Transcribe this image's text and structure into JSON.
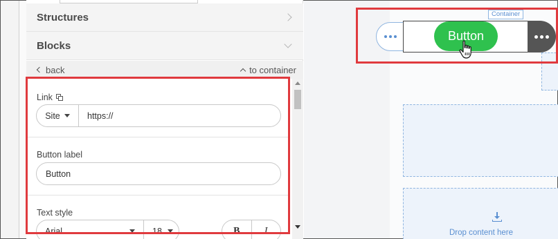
{
  "accordion": {
    "structures_label": "Structures",
    "blocks_label": "Blocks"
  },
  "nav": {
    "back_label": "back",
    "to_container_label": "to container"
  },
  "settings": {
    "link_label": "Link",
    "link_type_value": "Site",
    "link_url_value": "https://",
    "button_label_label": "Button label",
    "button_label_value": "Button",
    "text_style_label": "Text style",
    "font_value": "Arial",
    "font_size_value": "18",
    "bold_label": "B",
    "italic_label": "I"
  },
  "canvas": {
    "container_tag": "Container",
    "button_text": "Button",
    "drop_content_text": "Drop content here"
  },
  "colors": {
    "highlight": "#e03a3e",
    "button_green": "#2fc14e",
    "dashed_blue": "#8fb5e0"
  },
  "icons": {
    "link_copy": "copy-icon",
    "more_left": "more-horizontal-icon",
    "more_right": "more-horizontal-icon",
    "drop": "download-tray-icon",
    "cursor": "hand-pointer-icon"
  }
}
